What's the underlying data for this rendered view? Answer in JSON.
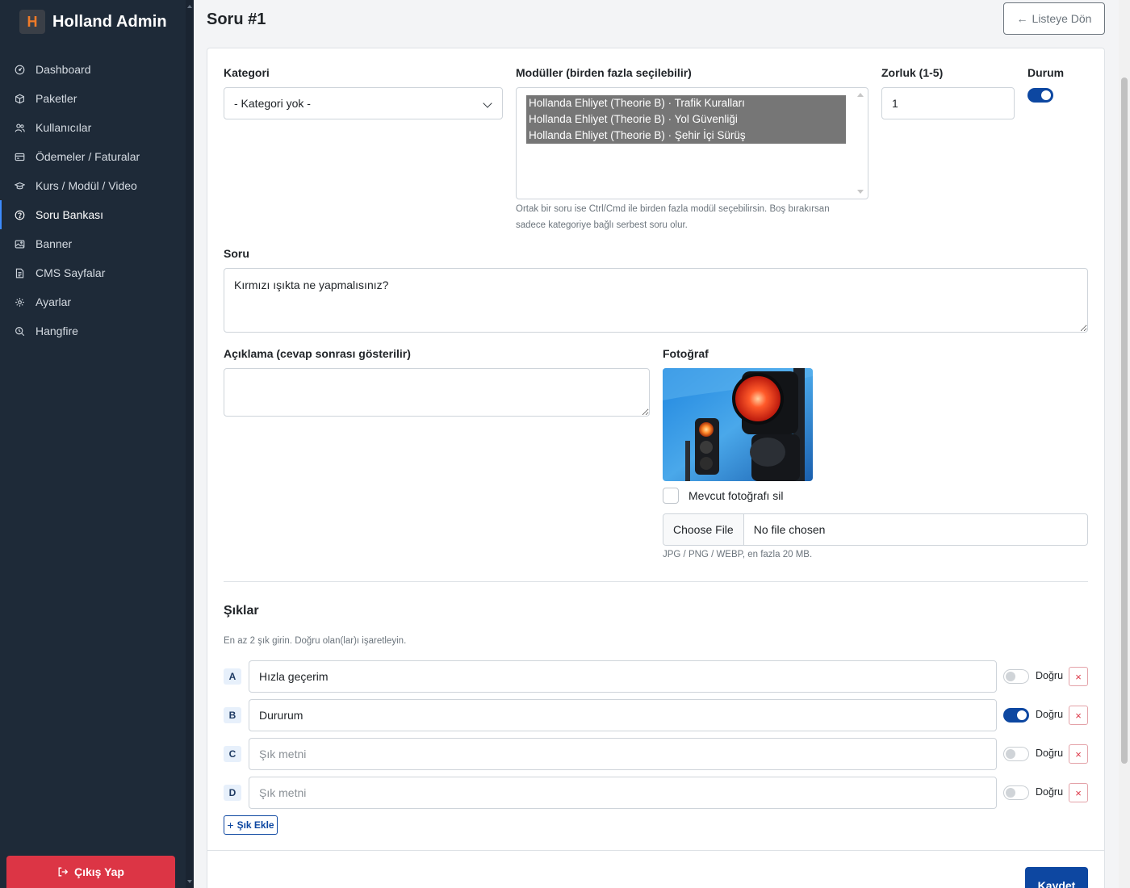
{
  "brand": {
    "logo_letter": "H",
    "name": "Holland Admin",
    "accent": "#f07b28"
  },
  "sidebar": {
    "items": [
      {
        "label": "Dashboard",
        "icon": "dashboard-icon"
      },
      {
        "label": "Paketler",
        "icon": "box-icon"
      },
      {
        "label": "Kullanıcılar",
        "icon": "users-icon"
      },
      {
        "label": "Ödemeler / Faturalar",
        "icon": "credit-card-icon"
      },
      {
        "label": "Kurs / Modül / Video",
        "icon": "mortarboard-icon"
      },
      {
        "label": "Soru Bankası",
        "icon": "question-circle-icon",
        "active": true
      },
      {
        "label": "Banner",
        "icon": "image-icon"
      },
      {
        "label": "CMS Sayfalar",
        "icon": "file-icon"
      },
      {
        "label": "Ayarlar",
        "icon": "gear-icon"
      },
      {
        "label": "Hangfire",
        "icon": "search-clock-icon"
      }
    ],
    "logout_label": "Çıkış Yap"
  },
  "header": {
    "title": "Soru #1",
    "back_label": "Listeye Dön"
  },
  "form": {
    "category": {
      "label": "Kategori",
      "value": "- Kategori yok -"
    },
    "modules": {
      "label": "Modüller (birden fazla seçilebilir)",
      "selected": [
        "Hollanda Ehliyet (Theorie B) · Trafik Kuralları",
        "Hollanda Ehliyet (Theorie B) · Yol Güvenliği",
        "Hollanda Ehliyet (Theorie B) · Şehir İçi Sürüş"
      ],
      "help_line1": "Ortak bir soru ise Ctrl/Cmd ile birden fazla modül seçebilirsin. Boş bırakırsan",
      "help_line2": "sadece kategoriye bağlı serbest soru olur."
    },
    "difficulty": {
      "label": "Zorluk (1-5)",
      "value": "1"
    },
    "status": {
      "label": "Durum",
      "on": true
    },
    "question": {
      "label": "Soru",
      "value": "Kırmızı ışıkta ne yapmalısınız?"
    },
    "explanation": {
      "label": "Açıklama (cevap sonrası gösterilir)",
      "value": ""
    },
    "photo": {
      "label": "Fotoğraf",
      "delete_label": "Mevcut fotoğrafı sil",
      "choose_label": "Choose File",
      "file_name": "No file chosen",
      "help": "JPG / PNG / WEBP, en fazla 20 MB."
    }
  },
  "choices": {
    "title": "Şıklar",
    "help": "En az 2 şık girin. Doğru olan(lar)ı işaretleyin.",
    "placeholder": "Şık metni",
    "correct_label": "Doğru",
    "delete_symbol": "×",
    "items": [
      {
        "letter": "A",
        "value": "Hızla geçerim",
        "correct": false
      },
      {
        "letter": "B",
        "value": "Dururum",
        "correct": true
      },
      {
        "letter": "C",
        "value": "",
        "correct": false
      },
      {
        "letter": "D",
        "value": "",
        "correct": false
      }
    ],
    "add_label": "Şık Ekle"
  },
  "save_label": "Kaydet",
  "colors": {
    "primary": "#0d47a1",
    "danger": "#dc3545",
    "sidebar_bg": "#1e2a38"
  }
}
